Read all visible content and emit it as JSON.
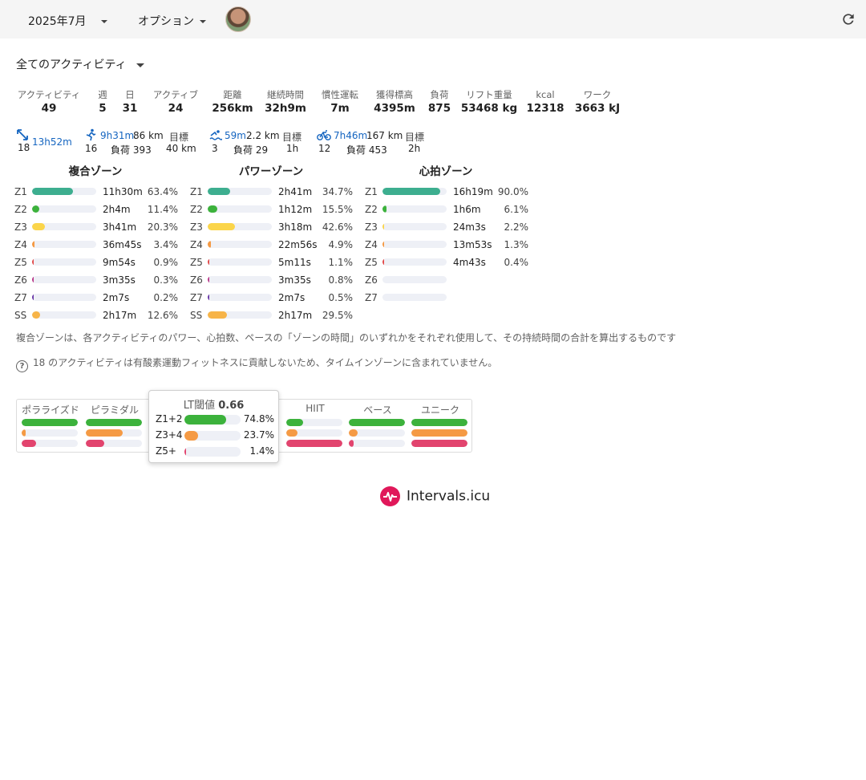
{
  "topbar": {
    "month": "2025年7月",
    "options": "オプション"
  },
  "filter": {
    "label": "全てのアクティビティ"
  },
  "stats": [
    {
      "label": "アクティビティ",
      "value": "49"
    },
    {
      "label": "週",
      "value": "5"
    },
    {
      "label": "日",
      "value": "31"
    },
    {
      "label": "アクティブ",
      "value": "24"
    },
    {
      "label": "距離",
      "value": "256km"
    },
    {
      "label": "継続時間",
      "value": "32h9m"
    },
    {
      "label": "慣性運転",
      "value": "7m"
    },
    {
      "label": "獲得標高",
      "value": "4395m"
    },
    {
      "label": "負荷",
      "value": "875"
    },
    {
      "label": "リフト重量",
      "value": "53468 kg"
    },
    {
      "label": "kcal",
      "value": "12318"
    },
    {
      "label": "ワーク",
      "value": "3663 kJ"
    }
  ],
  "sports": {
    "other": {
      "count": "18",
      "time": "13h52m"
    },
    "run": {
      "time": "9h31m",
      "dist": "86 km",
      "count": "16",
      "load": "負荷 393",
      "target_label": "目標",
      "target": "40 km"
    },
    "swim": {
      "time": "59m",
      "dist": "2.2 km",
      "count": "3",
      "load": "負荷 29",
      "target_label": "目標",
      "target": "1h"
    },
    "ride": {
      "time": "7h46m",
      "dist": "167 km",
      "count": "12",
      "load": "負荷 453",
      "target_label": "目標",
      "target": "2h"
    }
  },
  "zones": {
    "combined": {
      "title": "複合ゾーン",
      "rows": [
        {
          "z": "Z1",
          "time": "11h30m",
          "pct": "63.4%",
          "frac": 0.634,
          "color": "#3dae8f"
        },
        {
          "z": "Z2",
          "time": "2h4m",
          "pct": "11.4%",
          "frac": 0.114,
          "color": "#3cb23c"
        },
        {
          "z": "Z3",
          "time": "3h41m",
          "pct": "20.3%",
          "frac": 0.203,
          "color": "#fbd54a"
        },
        {
          "z": "Z4",
          "time": "36m45s",
          "pct": "3.4%",
          "frac": 0.034,
          "color": "#f59a44"
        },
        {
          "z": "Z5",
          "time": "9m54s",
          "pct": "0.9%",
          "frac": 0.009,
          "color": "#e24a4a"
        },
        {
          "z": "Z6",
          "time": "3m35s",
          "pct": "0.3%",
          "frac": 0.003,
          "color": "#b93a8a"
        },
        {
          "z": "Z7",
          "time": "2m7s",
          "pct": "0.2%",
          "frac": 0.002,
          "color": "#6b3aa8"
        },
        {
          "z": "SS",
          "time": "2h17m",
          "pct": "12.6%",
          "frac": 0.126,
          "color": "#f7b448"
        }
      ]
    },
    "power": {
      "title": "パワーゾーン",
      "rows": [
        {
          "z": "Z1",
          "time": "2h41m",
          "pct": "34.7%",
          "frac": 0.347,
          "color": "#3dae8f"
        },
        {
          "z": "Z2",
          "time": "1h12m",
          "pct": "15.5%",
          "frac": 0.155,
          "color": "#3cb23c"
        },
        {
          "z": "Z3",
          "time": "3h18m",
          "pct": "42.6%",
          "frac": 0.426,
          "color": "#fbd54a"
        },
        {
          "z": "Z4",
          "time": "22m56s",
          "pct": "4.9%",
          "frac": 0.049,
          "color": "#f59a44"
        },
        {
          "z": "Z5",
          "time": "5m11s",
          "pct": "1.1%",
          "frac": 0.011,
          "color": "#e24a4a"
        },
        {
          "z": "Z6",
          "time": "3m35s",
          "pct": "0.8%",
          "frac": 0.008,
          "color": "#b93a8a"
        },
        {
          "z": "Z7",
          "time": "2m7s",
          "pct": "0.5%",
          "frac": 0.005,
          "color": "#6b3aa8"
        },
        {
          "z": "SS",
          "time": "2h17m",
          "pct": "29.5%",
          "frac": 0.295,
          "color": "#f7b448"
        }
      ]
    },
    "hr": {
      "title": "心拍ゾーン",
      "rows": [
        {
          "z": "Z1",
          "time": "16h19m",
          "pct": "90.0%",
          "frac": 0.9,
          "color": "#3dae8f"
        },
        {
          "z": "Z2",
          "time": "1h6m",
          "pct": "6.1%",
          "frac": 0.061,
          "color": "#3cb23c"
        },
        {
          "z": "Z3",
          "time": "24m3s",
          "pct": "2.2%",
          "frac": 0.022,
          "color": "#fbd54a"
        },
        {
          "z": "Z4",
          "time": "13m53s",
          "pct": "1.3%",
          "frac": 0.013,
          "color": "#f59a44"
        },
        {
          "z": "Z5",
          "time": "4m43s",
          "pct": "0.4%",
          "frac": 0.004,
          "color": "#e24a4a"
        },
        {
          "z": "Z6",
          "time": "",
          "pct": "",
          "frac": 0,
          "color": "#b93a8a"
        },
        {
          "z": "Z7",
          "time": "",
          "pct": "",
          "frac": 0,
          "color": "#6b3aa8"
        }
      ]
    }
  },
  "notes": {
    "combined": "複合ゾーンは、各アクティビティのパワー、心拍数、ペースの「ゾーンの時間」のいずれかをそれぞれ使用して、その持続時間の合計を算出するものです",
    "aerobic": "18 のアクティビティは有酸素運動フィットネスに貢献しないため、タイムインゾーンに含まれていません。"
  },
  "distribution": [
    {
      "name": "ポラライズド",
      "bars": [
        {
          "frac": 1.0,
          "color": "#3cb23c"
        },
        {
          "frac": 0.07,
          "color": "#f59a44"
        },
        {
          "frac": 0.25,
          "color": "#e2446e"
        }
      ]
    },
    {
      "name": "ピラミダル",
      "bars": [
        {
          "frac": 1.0,
          "color": "#3cb23c"
        },
        {
          "frac": 0.65,
          "color": "#f59a44"
        },
        {
          "frac": 0.33,
          "color": "#e2446e"
        }
      ]
    },
    {
      "name": "",
      "bars": [
        {
          "frac": 0,
          "color": "#3cb23c"
        },
        {
          "frac": 0,
          "color": "#f59a44"
        },
        {
          "frac": 0,
          "color": "#e2446e"
        }
      ]
    },
    {
      "name": "",
      "bars": [
        {
          "frac": 0,
          "color": "#3cb23c"
        },
        {
          "frac": 0,
          "color": "#f59a44"
        },
        {
          "frac": 0,
          "color": "#e2446e"
        }
      ]
    },
    {
      "name": "HIIT",
      "bars": [
        {
          "frac": 0.3,
          "color": "#3cb23c"
        },
        {
          "frac": 0.2,
          "color": "#f59a44"
        },
        {
          "frac": 1.0,
          "color": "#e2446e"
        }
      ]
    },
    {
      "name": "ベース",
      "bars": [
        {
          "frac": 1.0,
          "color": "#3cb23c"
        },
        {
          "frac": 0.15,
          "color": "#f59a44"
        },
        {
          "frac": 0.08,
          "color": "#e2446e"
        }
      ]
    },
    {
      "name": "ユニーク",
      "bars": [
        {
          "frac": 1.0,
          "color": "#3cb23c"
        },
        {
          "frac": 1.0,
          "color": "#f59a44"
        },
        {
          "frac": 1.0,
          "color": "#e2446e"
        }
      ]
    }
  ],
  "tooltip": {
    "title": "LT閾値",
    "value": "0.66",
    "rows": [
      {
        "label": "Z1+2",
        "pct": "74.8%",
        "frac": 0.748,
        "color": "#3cb23c"
      },
      {
        "label": "Z3+4",
        "pct": "23.7%",
        "frac": 0.237,
        "color": "#f59a44"
      },
      {
        "label": "Z5+",
        "pct": "1.4%",
        "frac": 0.014,
        "color": "#e2446e"
      }
    ]
  },
  "brand": {
    "name": "Intervals.icu"
  }
}
